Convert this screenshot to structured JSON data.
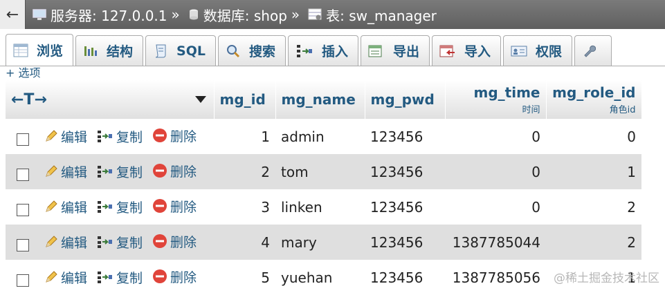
{
  "breadcrumb": {
    "back_label": "←",
    "server": "服务器: 127.0.0.1",
    "sep1": "»",
    "database": "数据库: shop",
    "sep2": "»",
    "table": "表: sw_manager"
  },
  "tabs": [
    {
      "label": "浏览",
      "icon": "browse-icon",
      "active": true
    },
    {
      "label": "结构",
      "icon": "structure-icon"
    },
    {
      "label": "SQL",
      "icon": "sql-icon"
    },
    {
      "label": "搜索",
      "icon": "search-icon"
    },
    {
      "label": "插入",
      "icon": "insert-icon"
    },
    {
      "label": "导出",
      "icon": "export-icon"
    },
    {
      "label": "导入",
      "icon": "import-icon"
    },
    {
      "label": "权限",
      "icon": "privileges-icon"
    }
  ],
  "options_link": "+ 选项",
  "table": {
    "move_columns": "←T→",
    "columns": [
      {
        "label": "mg_id",
        "sub": ""
      },
      {
        "label": "mg_name",
        "sub": ""
      },
      {
        "label": "mg_pwd",
        "sub": ""
      },
      {
        "label": "mg_time",
        "sub": "时间"
      },
      {
        "label": "mg_role_id",
        "sub": "角色id"
      }
    ],
    "actions": {
      "edit": "编辑",
      "copy": "复制",
      "delete": "删除"
    },
    "rows": [
      {
        "mg_id": "1",
        "mg_name": "admin",
        "mg_pwd": "123456",
        "mg_time": "0",
        "mg_role_id": "0"
      },
      {
        "mg_id": "2",
        "mg_name": "tom",
        "mg_pwd": "123456",
        "mg_time": "0",
        "mg_role_id": "1"
      },
      {
        "mg_id": "3",
        "mg_name": "linken",
        "mg_pwd": "123456",
        "mg_time": "0",
        "mg_role_id": "2"
      },
      {
        "mg_id": "4",
        "mg_name": "mary",
        "mg_pwd": "123456",
        "mg_time": "1387785044",
        "mg_role_id": "2"
      },
      {
        "mg_id": "5",
        "mg_name": "yuehan",
        "mg_pwd": "123456",
        "mg_time": "1387785056",
        "mg_role_id": "1"
      }
    ]
  },
  "watermark": "@稀土掘金技术社区",
  "colors": {
    "link": "#235a81",
    "row_alt": "#dfdfdf",
    "topbar": "#6b6b6b",
    "delete": "#e0443a"
  }
}
